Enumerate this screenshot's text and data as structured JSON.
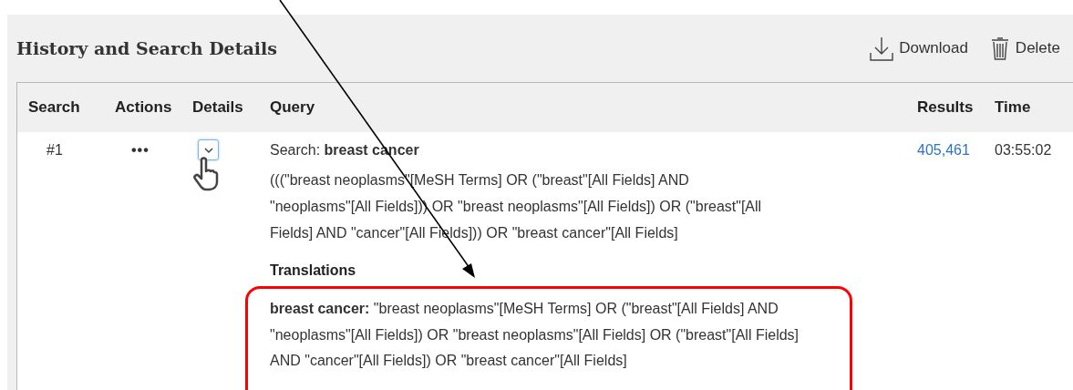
{
  "title": "History and Search Details",
  "actions": [
    {
      "kind": "download",
      "label": "Download"
    },
    {
      "kind": "delete",
      "label": "Delete"
    }
  ],
  "columns": [
    "Search",
    "Actions",
    "Details",
    "Query",
    "Results",
    "Time"
  ],
  "rows": [
    {
      "search": "#1",
      "actions": "•••",
      "expanded": true,
      "query_label": "Search:",
      "query_term": "breast cancer",
      "query_detail": "(((\"breast neoplasms\"[MeSH Terms] OR (\"breast\"[All Fields] AND \"neoplasms\"[All Fields])) OR \"breast neoplasms\"[All Fields]) OR (\"breast\"[All Fields] AND \"cancer\"[All Fields])) OR \"breast cancer\"[All Fields]",
      "results": "405,461",
      "time": "03:55:02",
      "translations_heading": "Translations",
      "translations_text": "**breast cancer:** \"breast neoplasms\"[MeSH Terms] OR (\"breast\"[All Fields] AND \"neoplasms\"[All Fields]) OR \"breast neoplasms\"[All Fields] OR (\"breast\"[All Fields] AND \"cancer\"[All Fields]) OR \"breast cancer\"[All Fields]"
    }
  ]
}
